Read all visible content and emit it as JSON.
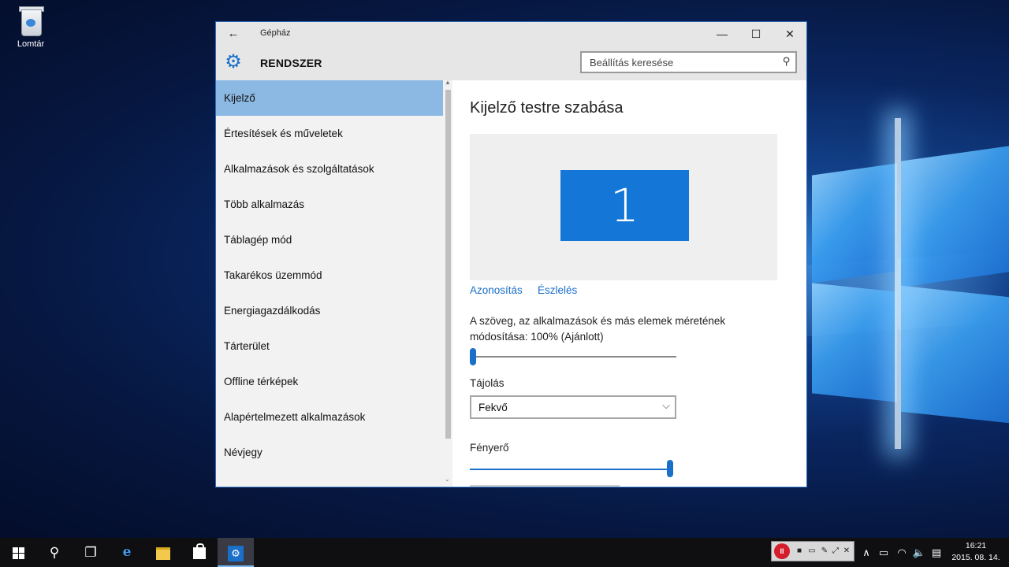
{
  "desktop": {
    "icons": [
      {
        "label": "Lomtár",
        "icon": "recycle-bin-icon"
      }
    ]
  },
  "window": {
    "title": "Gépház",
    "back_icon": "←",
    "controls": {
      "minimize": "—",
      "maximize": "☐",
      "close": "✕"
    },
    "section_icon": "⚙",
    "section_title": "RENDSZER",
    "search": {
      "placeholder": "Beállítás keresése",
      "icon": "⚲"
    }
  },
  "sidebar": {
    "items": [
      {
        "label": "Kijelző",
        "active": true
      },
      {
        "label": "Értesítések és műveletek",
        "active": false
      },
      {
        "label": "Alkalmazások és szolgáltatások",
        "active": false
      },
      {
        "label": "Több alkalmazás",
        "active": false
      },
      {
        "label": "Táblagép mód",
        "active": false
      },
      {
        "label": "Takarékos üzemmód",
        "active": false
      },
      {
        "label": "Energiagazdálkodás",
        "active": false
      },
      {
        "label": "Tárterület",
        "active": false
      },
      {
        "label": "Offline térképek",
        "active": false
      },
      {
        "label": "Alapértelmezett alkalmazások",
        "active": false
      },
      {
        "label": "Névjegy",
        "active": false
      }
    ]
  },
  "main": {
    "title": "Kijelző testre szabása",
    "monitor_number": "1",
    "links": {
      "identify": "Azonosítás",
      "detect": "Észlelés"
    },
    "scale": {
      "label": "A szöveg, az alkalmazások és más elemek méretének módosítása: 100% (Ajánlott)",
      "level": 0
    },
    "orientation": {
      "label": "Tájolás",
      "value": "Fekvő",
      "chevron": "⌵"
    },
    "brightness": {
      "label": "Fényerő",
      "level": 1.0
    }
  },
  "taskbar": {
    "search_icon": "⚲",
    "taskview_icon": "❐",
    "edge_icon": "e",
    "settings_icon": "⚙",
    "recording_toolbar": {
      "stop": "II",
      "icons": [
        "■",
        "▭",
        "✎",
        "⤢",
        "✕"
      ]
    },
    "tray": {
      "chevron": "∧",
      "battery": "▭",
      "network": "◠",
      "volume": "🔈",
      "notifications": "▤"
    },
    "clock": {
      "time": "16:21",
      "date": "2015. 08. 14."
    }
  },
  "colors": {
    "accent": "#1a6fc9",
    "nav_active": "#8cb9e3",
    "monitor": "#1476d6",
    "taskbar": "#0f0f12"
  }
}
